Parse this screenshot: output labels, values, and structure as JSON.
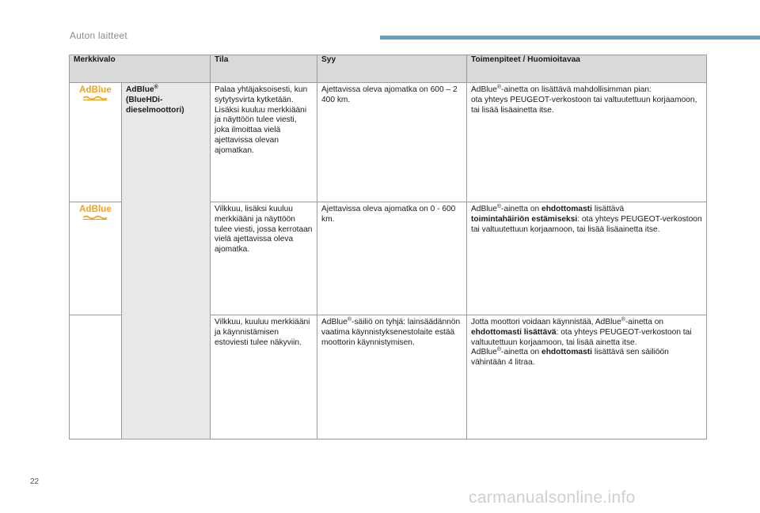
{
  "header": {
    "section_title": "Auton laitteet",
    "accent_color": "#5fa2bd"
  },
  "table": {
    "columns": [
      "Merkkivalo",
      "Tila",
      "Syy",
      "Toimenpiteet / Huomioitavaa"
    ],
    "warning_light": {
      "icon_label": "AdBlue",
      "icon_color": "#f2a21b",
      "name_line1": "AdBlue",
      "name_sup": "®",
      "name_line2": "(BlueHDi-",
      "name_line3": "dieselmoottori)"
    },
    "rows": [
      {
        "state": "Palaa yhtäjaksoisesti, kun sytytysvirta kytketään. Lisäksi kuuluu merkkiääni ja näyttöön tulee viesti, joka ilmoittaa vielä ajettavissa olevan ajomatkan.",
        "cause": "Ajettavissa oleva ajomatka on 600 – 2 400 km.",
        "action": {
          "p1_a": "AdBlue",
          "p1_sup": "®",
          "p1_b": "-ainetta on lisättävä mahdollisimman pian:",
          "p1_c": "ota yhteys PEUGEOT-verkostoon tai valtuutettuun korjaamoon, tai lisää lisäainetta itse."
        }
      },
      {
        "state": "Vilkkuu, lisäksi kuuluu merkkiääni ja näyttöön tulee viesti, jossa kerrotaan vielä ajettavissa oleva ajomatka.",
        "cause": "Ajettavissa oleva ajomatka on 0 - 600 km.",
        "action": {
          "p1_a": "AdBlue",
          "p1_sup": "®",
          "p1_b": "-ainetta on ",
          "p1_bold1": "ehdottomasti",
          "p1_c": " lisättävä",
          "p1_bold2": "toimintahäiriön estämiseksi",
          "p1_d": ": ota yhteys PEUGEOT-verkostoon tai valtuutettuun korjaamoon, tai lisää lisäainetta itse."
        }
      },
      {
        "state": "Vilkkuu, kuuluu merkkiääni ja käynnistämisen estoviesti tulee näkyviin.",
        "cause_a": "AdBlue",
        "cause_sup": "®",
        "cause_b": "-säiliö on tyhjä: lainsäädännön vaatima käynnistyksenestolaite estää moottorin käynnistymisen.",
        "action": {
          "p1_a": "Jotta moottori voidaan käynnistää, AdBlue",
          "p1_sup": "®",
          "p1_b": "-ainetta on",
          "p1_bold1": "ehdottomasti lisättävä",
          "p1_c": ": ota yhteys PEUGEOT-verkostoon tai valtuutettuun korjaamoon, tai lisää ainetta itse.",
          "p2_a": "AdBlue",
          "p2_sup": "®",
          "p2_b": "-ainetta on ",
          "p2_bold": "ehdottomasti",
          "p2_c": " lisättävä sen säiliöön vähintään 4 litraa."
        }
      }
    ]
  },
  "footer": {
    "page_number": "22",
    "watermark": "carmanualsonline.info"
  }
}
